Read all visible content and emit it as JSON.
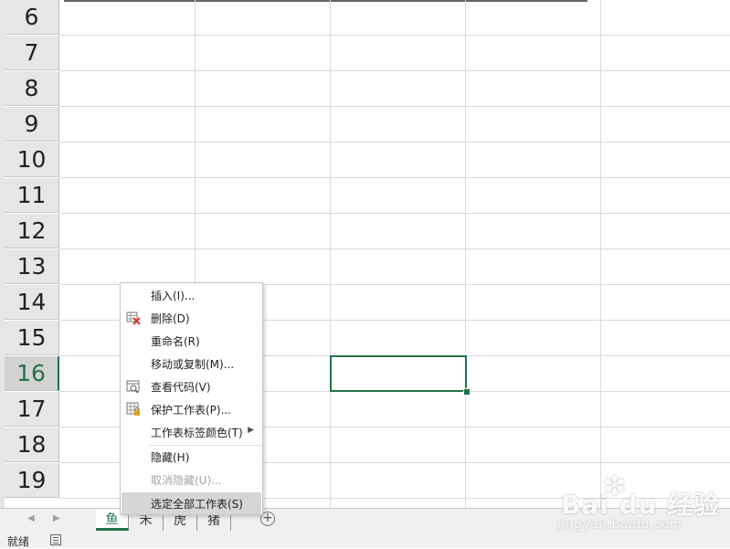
{
  "sheet": {
    "row_numbers": [
      "6",
      "7",
      "8",
      "9",
      "10",
      "11",
      "12",
      "13",
      "14",
      "15",
      "16",
      "17",
      "18",
      "19"
    ],
    "active_row": "16"
  },
  "sheet_tabs": {
    "tabs": [
      "鱼",
      "禾",
      "虎",
      "猪"
    ],
    "active_tab": "鱼"
  },
  "status_bar": {
    "ready_label": "就绪"
  },
  "context_menu": {
    "items": [
      {
        "label": "插入(I)...",
        "enabled": true
      },
      {
        "label": "删除(D)",
        "enabled": true
      },
      {
        "label": "重命名(R)",
        "enabled": true
      },
      {
        "label": "移动或复制(M)...",
        "enabled": true
      },
      {
        "label": "查看代码(V)",
        "enabled": true
      },
      {
        "label": "保护工作表(P)...",
        "enabled": true
      },
      {
        "label": "工作表标签颜色(T)",
        "enabled": true,
        "submenu": true
      },
      {
        "label": "隐藏(H)",
        "enabled": true
      },
      {
        "label": "取消隐藏(U)...",
        "enabled": false
      },
      {
        "label": "选定全部工作表(S)",
        "enabled": true,
        "highlighted": true
      }
    ]
  },
  "watermark": {
    "logo_text": "Bai du 经验",
    "url_text": "jingyan.baidu.com"
  },
  "colors": {
    "accent": "#217346",
    "menu_highlight": "#d6d6d6",
    "header_bg": "#e6e6e6"
  }
}
